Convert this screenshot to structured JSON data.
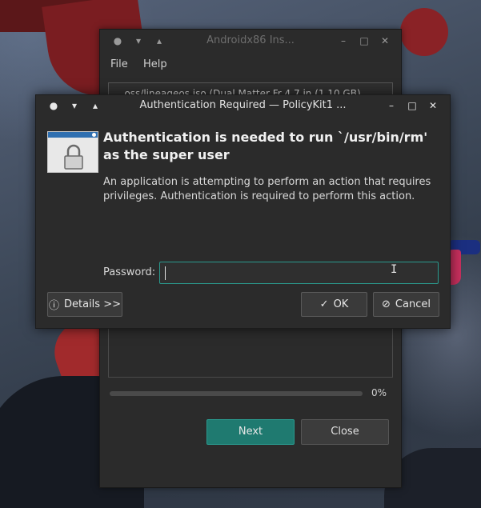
{
  "back_window": {
    "title": "Androidx86 Ins...",
    "menu": [
      "File",
      "Help"
    ],
    "combo_text": "...oss/lineageos.iso (Dual Matter Fr 4.7 in (1.10 GB)",
    "progress_percent": 0,
    "progress_label": "0%",
    "next_label": "Next",
    "close_label": "Close"
  },
  "dialog": {
    "title": "Authentication Required — PolicyKit1 ...",
    "heading": "Authentication is needed to run `/usr/bin/rm' as the super user",
    "body": "An application is attempting to perform an action that requires privileges. Authentication is required to perform this action.",
    "password_label": "Password:",
    "password_value": "",
    "details_label": "Details >>",
    "ok_label": "OK",
    "cancel_label": "Cancel"
  },
  "icons": {
    "window_menu": "●",
    "minimize_arrow": "▾",
    "restore_arrow": "▴",
    "minimize": "–",
    "maximize": "□",
    "close": "✕",
    "info": "ⓘ",
    "check": "✓",
    "cancel": "⊘",
    "text_cursor": "I"
  },
  "colors": {
    "accent": "#26a69a",
    "dialog_bg": "#2b2b2b",
    "lock_header": "#2f6fb0"
  }
}
